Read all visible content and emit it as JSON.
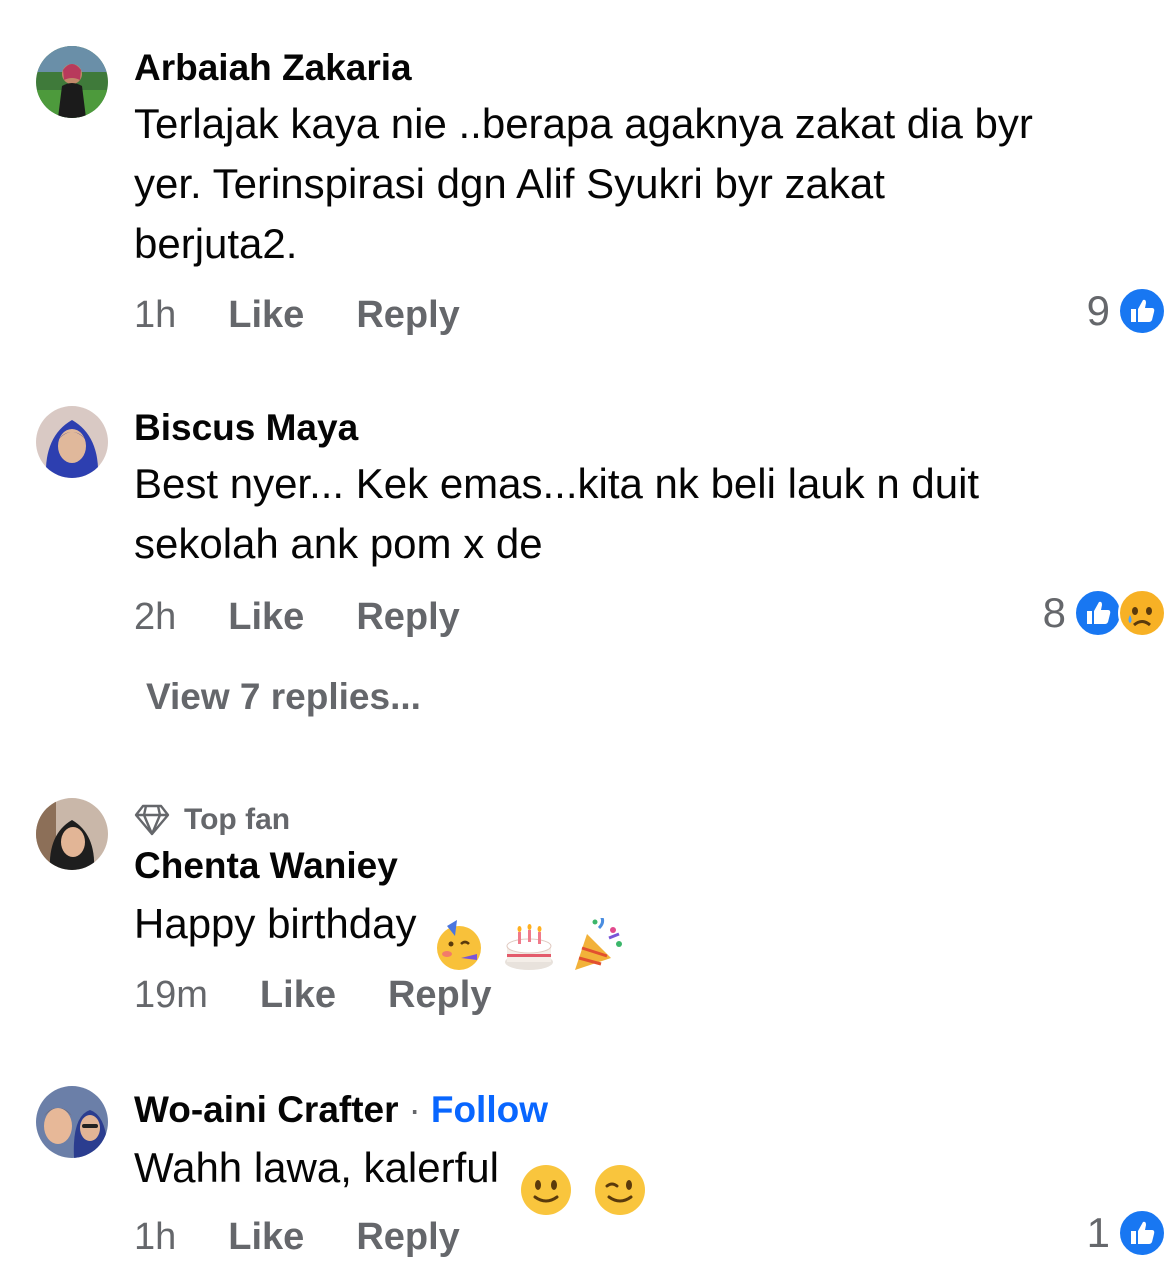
{
  "comments": [
    {
      "author": "Arbaiah Zakaria",
      "text": "Terlajak kaya nie ..berapa agaknya zakat dia byr\nyer. Terinspirasi dgn Alif Syukri byr zakat\nberjuta2.",
      "time": "1h",
      "like_label": "Like",
      "reply_label": "Reply",
      "reaction_count": "9",
      "reactions": [
        "like-icon"
      ]
    },
    {
      "author": "Biscus Maya",
      "text": "Best nyer... Kek emas...kita nk beli lauk n duit\nsekolah ank pom x de",
      "time": "2h",
      "like_label": "Like",
      "reply_label": "Reply",
      "reaction_count": "8",
      "reactions": [
        "like-icon",
        "sad-icon"
      ],
      "view_replies": "View 7 replies..."
    },
    {
      "badge": "Top fan",
      "author": "Chenta Waniey",
      "text": "Happy birthday",
      "emojis": [
        "partying-face-emoji",
        "birthday-cake-emoji",
        "party-popper-emoji"
      ],
      "time": "19m",
      "like_label": "Like",
      "reply_label": "Reply"
    },
    {
      "author": "Wo-aini Crafter",
      "separator": "·",
      "follow_label": "Follow",
      "text": "Wahh lawa, kalerful",
      "emojis": [
        "slightly-smiling-face-emoji",
        "winking-face-emoji"
      ],
      "time": "1h",
      "like_label": "Like",
      "reply_label": "Reply",
      "reaction_count": "1",
      "reactions": [
        "like-icon"
      ]
    }
  ],
  "colors": {
    "text": "#050505",
    "secondary": "#65676b",
    "link": "#0866ff",
    "like_blue": "#1877f2"
  }
}
